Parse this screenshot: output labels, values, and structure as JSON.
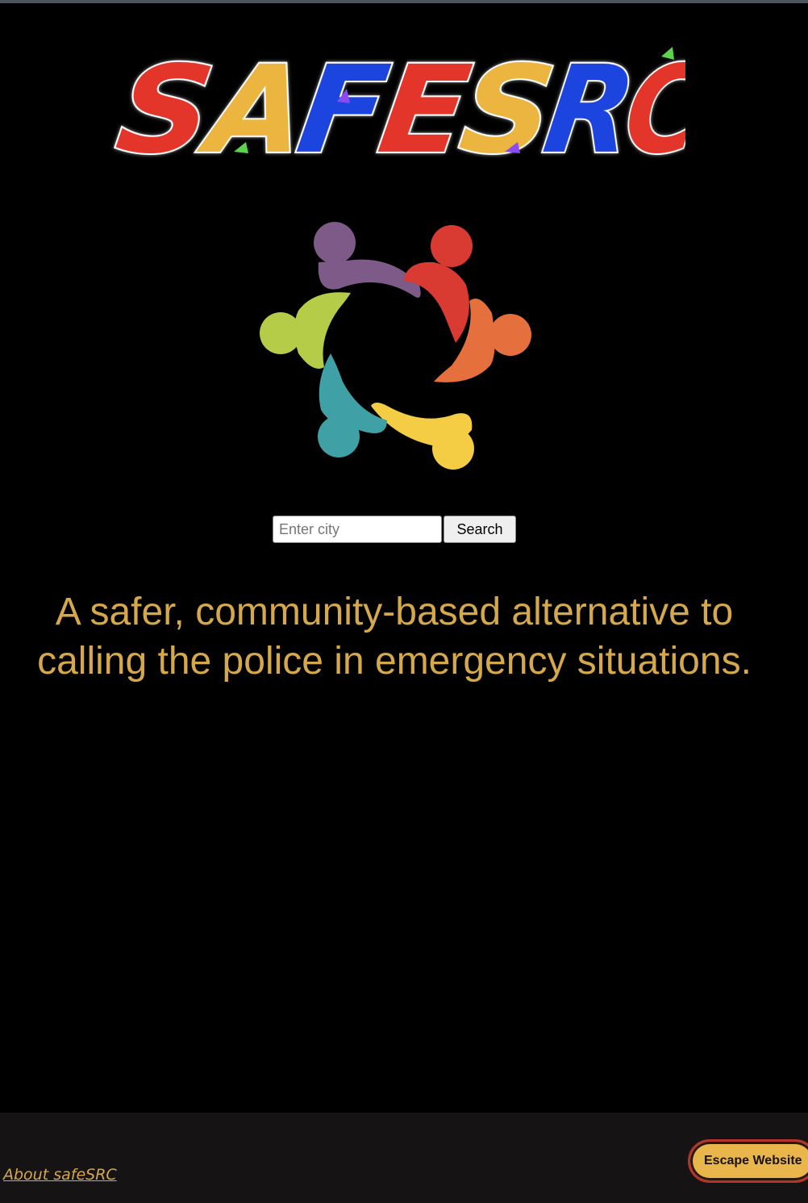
{
  "header": {
    "wordmark": "SAFESRC"
  },
  "brand_colors": {
    "red": "#e3352c",
    "yellow": "#ecb540",
    "blue": "#1e44e0",
    "gold_text": "#d4a84b"
  },
  "community_logo": {
    "icon": "community-circle-icon",
    "figure_colors": [
      "#7d5a87",
      "#d93a32",
      "#e5703d",
      "#f5cd45",
      "#3fa0a6",
      "#b5cc48"
    ]
  },
  "search": {
    "placeholder": "Enter city",
    "value": "",
    "button_label": "Search"
  },
  "tagline": {
    "line1": "A safer, community-based alternative to",
    "line2": "calling the police in emergency situations."
  },
  "footer": {
    "about_link": "About safeSRC",
    "escape_button": "Escape Website"
  }
}
